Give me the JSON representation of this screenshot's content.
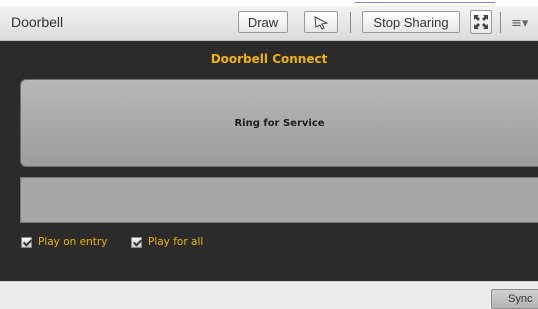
{
  "window": {
    "title": "Doorbell",
    "toolbar": {
      "draw_label": "Draw",
      "stop_sharing_label": "Stop Sharing"
    }
  },
  "pod": {
    "title": "Doorbell Connect",
    "ring_button_label": "Ring for Service",
    "message_field_value": "",
    "options": [
      {
        "label": "Play on entry",
        "checked": true
      },
      {
        "label": "Play for all",
        "checked": true
      }
    ]
  },
  "footer": {
    "sync_label": "Sync"
  },
  "colors": {
    "accent": "#f0b400",
    "panel_bg": "#2b2b2b"
  }
}
